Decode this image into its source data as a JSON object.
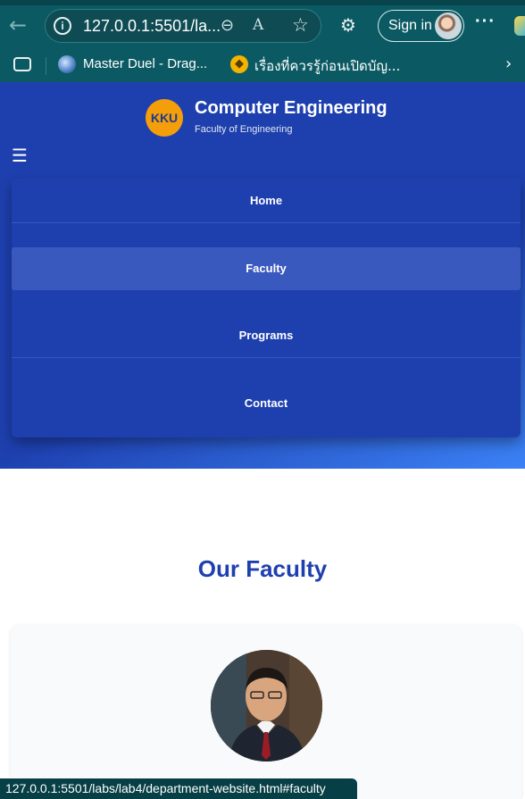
{
  "browser": {
    "url": "127.0.0.1:5501/la...",
    "signin_label": "Sign in",
    "more_label": "···",
    "bookmarks": [
      {
        "label": "Master Duel - Drag..."
      },
      {
        "label": "เรื่องที่ควรรู้ก่อนเปิดบัญ..."
      }
    ],
    "status_url": "127.0.0.1:5501/labs/lab4/department-website.html#faculty"
  },
  "site": {
    "logo_text": "KKU",
    "title": "Computer Engineering",
    "subtitle": "Faculty of Engineering",
    "menu_icon": "☰",
    "nav": [
      {
        "label": "Home"
      },
      {
        "label": "Faculty",
        "active": true
      },
      {
        "label": "Programs"
      },
      {
        "label": "Contact"
      }
    ]
  },
  "faculty_section": {
    "heading": "Our Faculty"
  },
  "colors": {
    "browser_chrome": "#0b5a63",
    "header_primary": "#1e40af",
    "header_gradient_end": "#3b82f6",
    "logo_accent": "#f59e0b",
    "heading": "#1e40af"
  },
  "icons": [
    "back-arrow-icon",
    "info-icon",
    "zoom-icon",
    "read-aloud-icon",
    "favorite-star-icon",
    "extensions-icon",
    "more-icon",
    "tab-actions-icon",
    "chevron-right-icon",
    "hamburger-menu-icon"
  ]
}
